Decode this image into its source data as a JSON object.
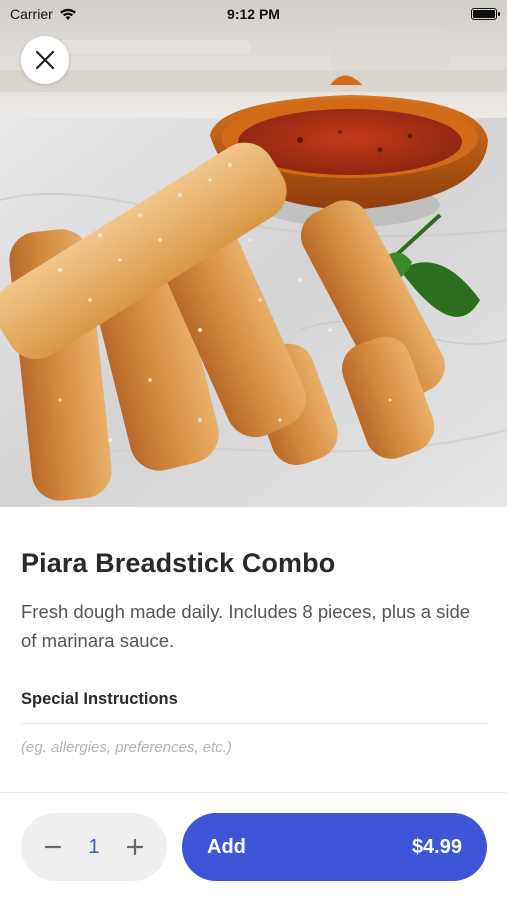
{
  "status_bar": {
    "carrier": "Carrier",
    "time": "9:12 PM",
    "icons": [
      "wifi-icon",
      "battery-icon"
    ]
  },
  "hero": {
    "image_subject": "breadsticks with marinara sauce and basil",
    "close_icon": "close-icon"
  },
  "item": {
    "title": "Piara Breadstick Combo",
    "description": "Fresh dough made daily. Includes 8 pieces, plus a side of marinara sauce."
  },
  "special_instructions": {
    "label": "Special Instructions",
    "placeholder": "(eg. allergies, preferences, etc.)",
    "value": ""
  },
  "order": {
    "quantity": "1",
    "minus_icon": "minus-icon",
    "plus_icon": "plus-icon",
    "add_label": "Add",
    "price": "$4.99"
  },
  "colors": {
    "accent": "#3d55d6",
    "stepper_bg": "#efefef",
    "text_primary": "#2a2a2a",
    "text_secondary": "#555555",
    "placeholder": "#b3b3b3"
  }
}
